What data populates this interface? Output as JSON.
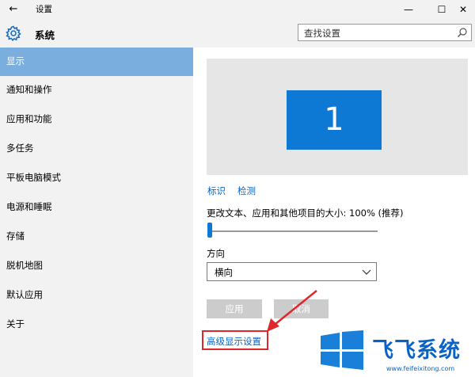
{
  "window": {
    "back_glyph": "←",
    "title": "设置",
    "min_glyph": "—",
    "max_glyph": "☐",
    "close_glyph": "✕"
  },
  "header": {
    "section_title": "系统",
    "search_placeholder": "查找设置",
    "gear_icon": "gear-icon",
    "search_icon": "search-icon"
  },
  "sidebar": {
    "items": [
      {
        "label": "显示",
        "active": true
      },
      {
        "label": "通知和操作"
      },
      {
        "label": "应用和功能"
      },
      {
        "label": "多任务"
      },
      {
        "label": "平板电脑模式"
      },
      {
        "label": "电源和睡眠"
      },
      {
        "label": "存储"
      },
      {
        "label": "脱机地图"
      },
      {
        "label": "默认应用"
      },
      {
        "label": "关于"
      }
    ]
  },
  "main": {
    "monitor_number": "1",
    "identify_link": "标识",
    "detect_link": "检测",
    "scale_label": "更改文本、应用和其他项目的大小: 100% (推荐)",
    "scale_value_percent": 100,
    "orientation_label": "方向",
    "orientation_value": "横向",
    "apply_button": "应用",
    "cancel_button": "取消",
    "advanced_link": "高级显示设置"
  },
  "watermark": {
    "brand_text": "飞飞系统",
    "url": "www.feifeixitong.com"
  },
  "colors": {
    "accent": "#0e78d5",
    "sidebar_active": "#79aede",
    "link": "#0066cc",
    "highlight_red": "#e0262d",
    "disabled_button": "#cccccc"
  }
}
